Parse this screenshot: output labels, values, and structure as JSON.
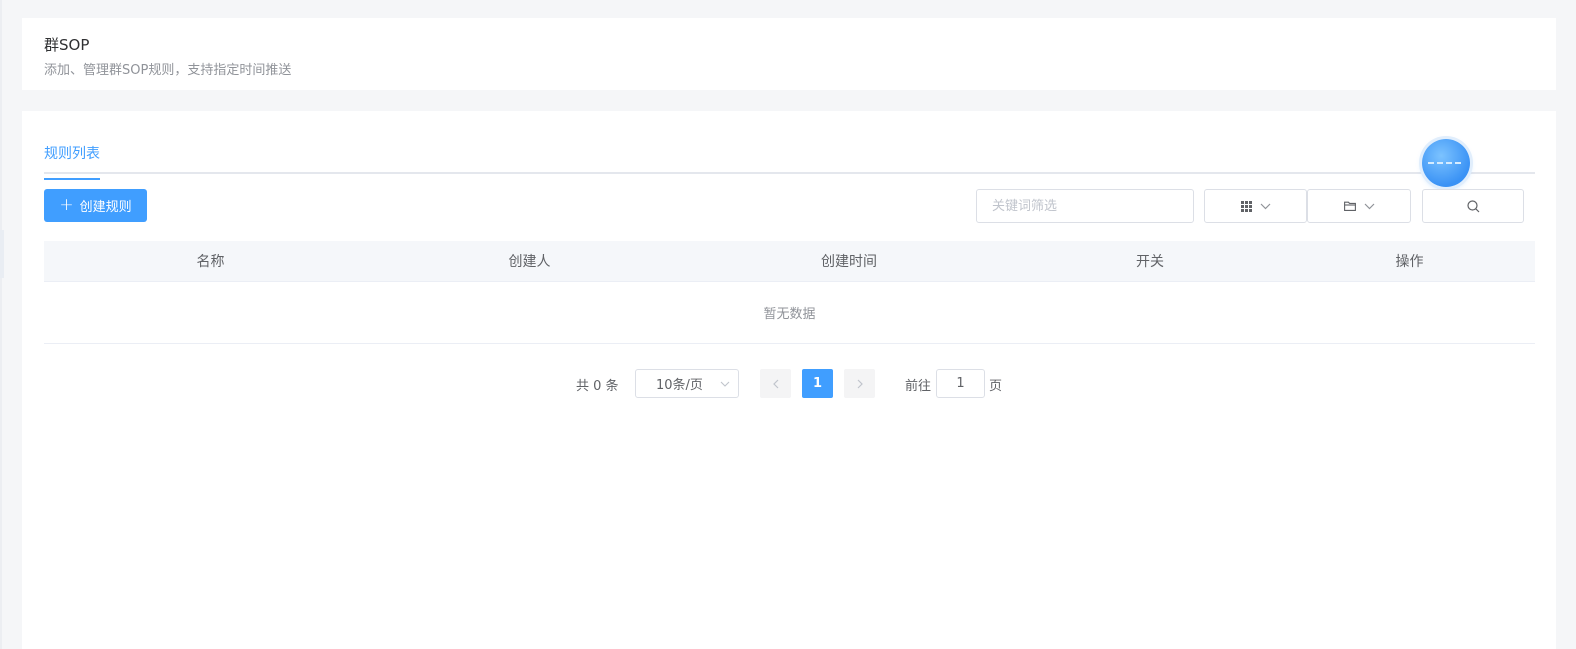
{
  "header": {
    "title": "群SOP",
    "description": "添加、管理群SOP规则，支持指定时间推送"
  },
  "tabs": [
    {
      "label": "规则列表",
      "active": true
    }
  ],
  "toolbar": {
    "create_label": "创建规则",
    "search_placeholder": "关键词筛选",
    "icons": [
      "plus-icon",
      "grid-icon",
      "chevron-down-icon",
      "folder-icon",
      "search-icon"
    ]
  },
  "table": {
    "columns": [
      "名称",
      "创建人",
      "创建时间",
      "开关",
      "操作"
    ],
    "rows": [],
    "empty_text": "暂无数据"
  },
  "pagination": {
    "total_label": "共 0 条",
    "page_size_label": "10条/页",
    "current_page": "1",
    "goto_label": "前往",
    "goto_value": "1",
    "page_unit": "页"
  },
  "colors": {
    "accent": "#409eff",
    "page_bg": "#f5f6f8",
    "header_row_bg": "#f5f7fa",
    "muted_text": "#909399"
  }
}
